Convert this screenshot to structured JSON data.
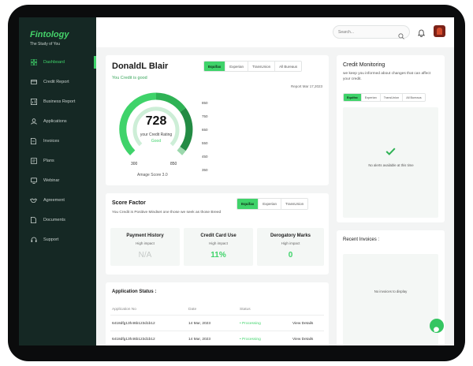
{
  "brand": {
    "name": "Fintology",
    "tagline": "The Study of You"
  },
  "sidebar": {
    "items": [
      {
        "label": "Dashboard",
        "icon": "dashboard-icon",
        "active": true
      },
      {
        "label": "Credit Report",
        "icon": "credit-card-icon"
      },
      {
        "label": "Business Report",
        "icon": "chart-icon"
      },
      {
        "label": "Applications",
        "icon": "user-icon"
      },
      {
        "label": "Invoices",
        "icon": "invoice-icon"
      },
      {
        "label": "Plans",
        "icon": "plans-icon"
      },
      {
        "label": "Webinar",
        "icon": "webinar-icon"
      },
      {
        "label": "Agreement",
        "icon": "handshake-icon"
      },
      {
        "label": "Documents",
        "icon": "document-icon"
      },
      {
        "label": "Support",
        "icon": "headset-icon"
      }
    ]
  },
  "header": {
    "search_placeholder": "Search..."
  },
  "profile": {
    "name": "DonaldL Blair",
    "subtitle": "You Credit is good",
    "tabs": [
      "Equifax",
      "Experian",
      "TransUnion",
      "All Bureaus"
    ],
    "active_tab": "Equifax",
    "report_date": "Report Mar 17,2023",
    "score": "728",
    "score_label": "your Credit Rating",
    "rating": "Good",
    "range_min": "300",
    "range_max": "850",
    "average": "Amage Score 3.0",
    "scale": [
      "850",
      "750",
      "650",
      "550",
      "450",
      "350"
    ]
  },
  "score_factor": {
    "title": "Score Factor",
    "description": "You Credit is Positive Mindset one those we seek as those Breed",
    "tabs": [
      "Equifax",
      "Experian",
      "TransUnion"
    ],
    "active_tab": "Equifax",
    "factors": [
      {
        "title": "Payment History",
        "impact": "High impact",
        "value": "N/A"
      },
      {
        "title": "Credit Card Use",
        "impact": "High impact",
        "value": "11%"
      },
      {
        "title": "Derogatory Marks",
        "impact": "High impact",
        "value": "0"
      }
    ]
  },
  "applications": {
    "title": "Application Status :",
    "columns": [
      "Application No",
      "Date",
      "Status",
      ""
    ],
    "rows": [
      {
        "id": "6418dfg13h46b123d1b12",
        "date": "14 Mar, 2023",
        "status": "Processing",
        "action": "View Details"
      },
      {
        "id": "6418dfg13h46b123d1b12",
        "date": "14 Mar, 2023",
        "status": "Processing",
        "action": "View Details"
      }
    ]
  },
  "monitoring": {
    "title": "Credit Monitoring",
    "description": "we keep you informed about changes that can affect your credit.",
    "tabs": [
      "Equifax",
      "Experian",
      "TransUnion",
      "All Bureaus"
    ],
    "active_tab": "Equifax",
    "empty_message": "No alerts available at this time"
  },
  "invoices": {
    "title": "Recent Invoices :",
    "empty_message": "No invoices to display"
  },
  "colors": {
    "accent": "#3fd36a",
    "sidebar": "#152824",
    "dark_green": "#238b44"
  }
}
